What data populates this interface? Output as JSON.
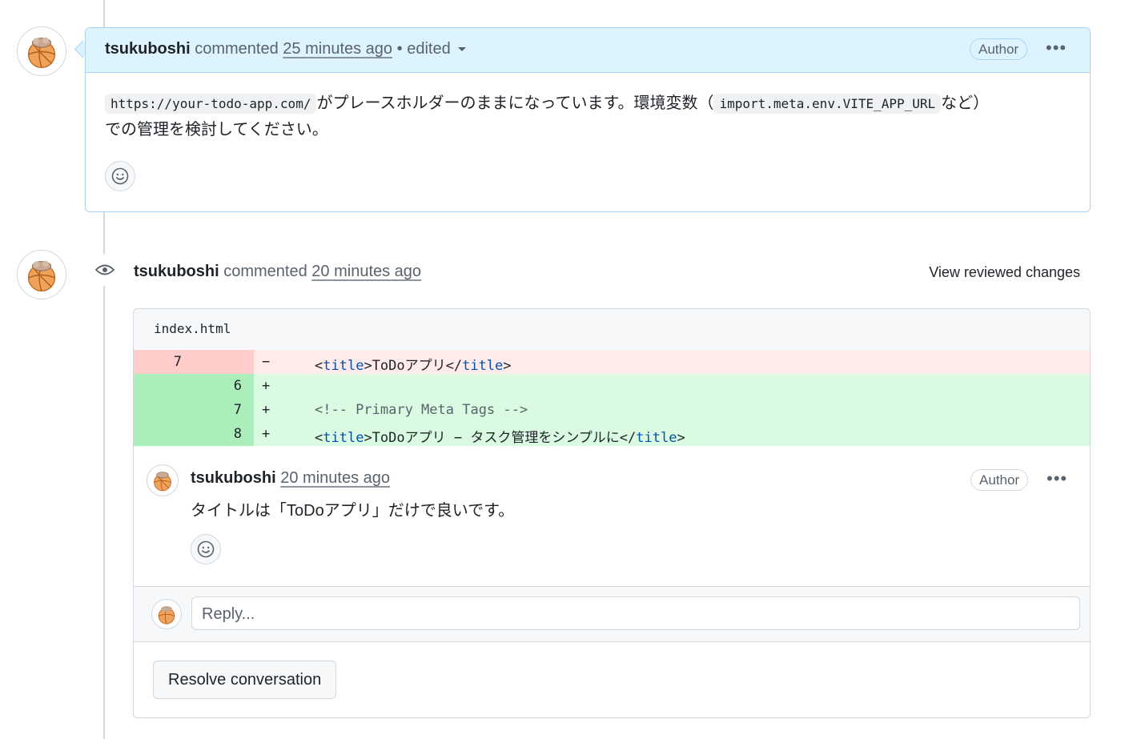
{
  "comment1": {
    "author": "tsukuboshi",
    "action": "commented",
    "time": "25 minutes ago",
    "separator": "•",
    "edited": "edited",
    "badge": "Author",
    "more": "•••",
    "body": {
      "code1": "https://your-todo-app.com/",
      "text1": "がプレースホルダーのままになっています。環境変数（",
      "code2": "import.meta.env.VITE_APP_URL",
      "text2": "など）",
      "text3": "での管理を検討してください。"
    }
  },
  "review": {
    "author": "tsukuboshi",
    "action": "commented",
    "time": "20 minutes ago",
    "view_changes": "View reviewed changes",
    "file": "index.html",
    "diff": [
      {
        "type": "del",
        "old": "7",
        "new": "",
        "sign": "−",
        "parts": [
          [
            "<",
            ""
          ],
          [
            "title",
            "kw"
          ],
          [
            ">ToDoアプリ</",
            ""
          ],
          [
            "title",
            "kw"
          ],
          [
            ">",
            ""
          ]
        ]
      },
      {
        "type": "add",
        "old": "",
        "new": "6",
        "sign": "+",
        "parts": []
      },
      {
        "type": "add",
        "old": "",
        "new": "7",
        "sign": "+",
        "parts": [
          [
            "<!-- Primary Meta Tags -->",
            "cmt"
          ]
        ]
      },
      {
        "type": "add",
        "old": "",
        "new": "8",
        "sign": "+",
        "parts": [
          [
            "<",
            ""
          ],
          [
            "title",
            "kw"
          ],
          [
            ">ToDoアプリ − タスク管理をシンプルに</",
            ""
          ],
          [
            "title",
            "kw"
          ],
          [
            ">",
            ""
          ]
        ]
      }
    ],
    "thread": {
      "author": "tsukuboshi",
      "time": "20 minutes ago",
      "badge": "Author",
      "more": "•••",
      "body": "タイトルは「ToDoアプリ」だけで良いです。"
    },
    "reply_placeholder": "Reply...",
    "resolve": "Resolve conversation"
  }
}
